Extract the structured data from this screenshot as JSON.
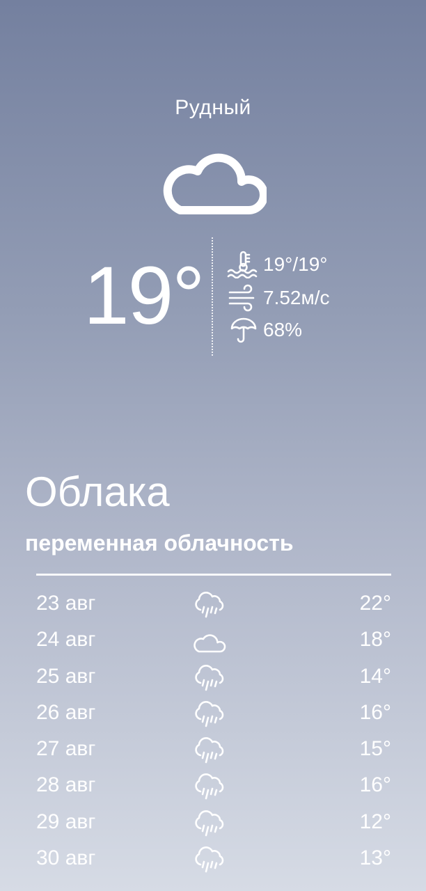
{
  "city": "Рудный",
  "current": {
    "icon": "cloud-icon",
    "temperature": "19°",
    "feels_like": "19°/19°",
    "wind": "7.52м/с",
    "humidity": "68%"
  },
  "condition": "Облака",
  "description": "переменная облачность",
  "forecast": [
    {
      "date": "23 авг",
      "icon": "rain-icon",
      "temp": "22°"
    },
    {
      "date": "24 авг",
      "icon": "cloud-icon",
      "temp": "18°"
    },
    {
      "date": "25 авг",
      "icon": "rain-icon",
      "temp": "14°"
    },
    {
      "date": "26 авг",
      "icon": "rain-icon",
      "temp": "16°"
    },
    {
      "date": "27 авг",
      "icon": "rain-icon",
      "temp": "15°"
    },
    {
      "date": "28 авг",
      "icon": "rain-icon",
      "temp": "16°"
    },
    {
      "date": "29 авг",
      "icon": "rain-icon",
      "temp": "12°"
    },
    {
      "date": "30 авг",
      "icon": "rain-icon",
      "temp": "13°"
    }
  ],
  "colors": {
    "gradient_top": "#74809f",
    "gradient_bottom": "#d6dbe5",
    "text": "#ffffff"
  }
}
